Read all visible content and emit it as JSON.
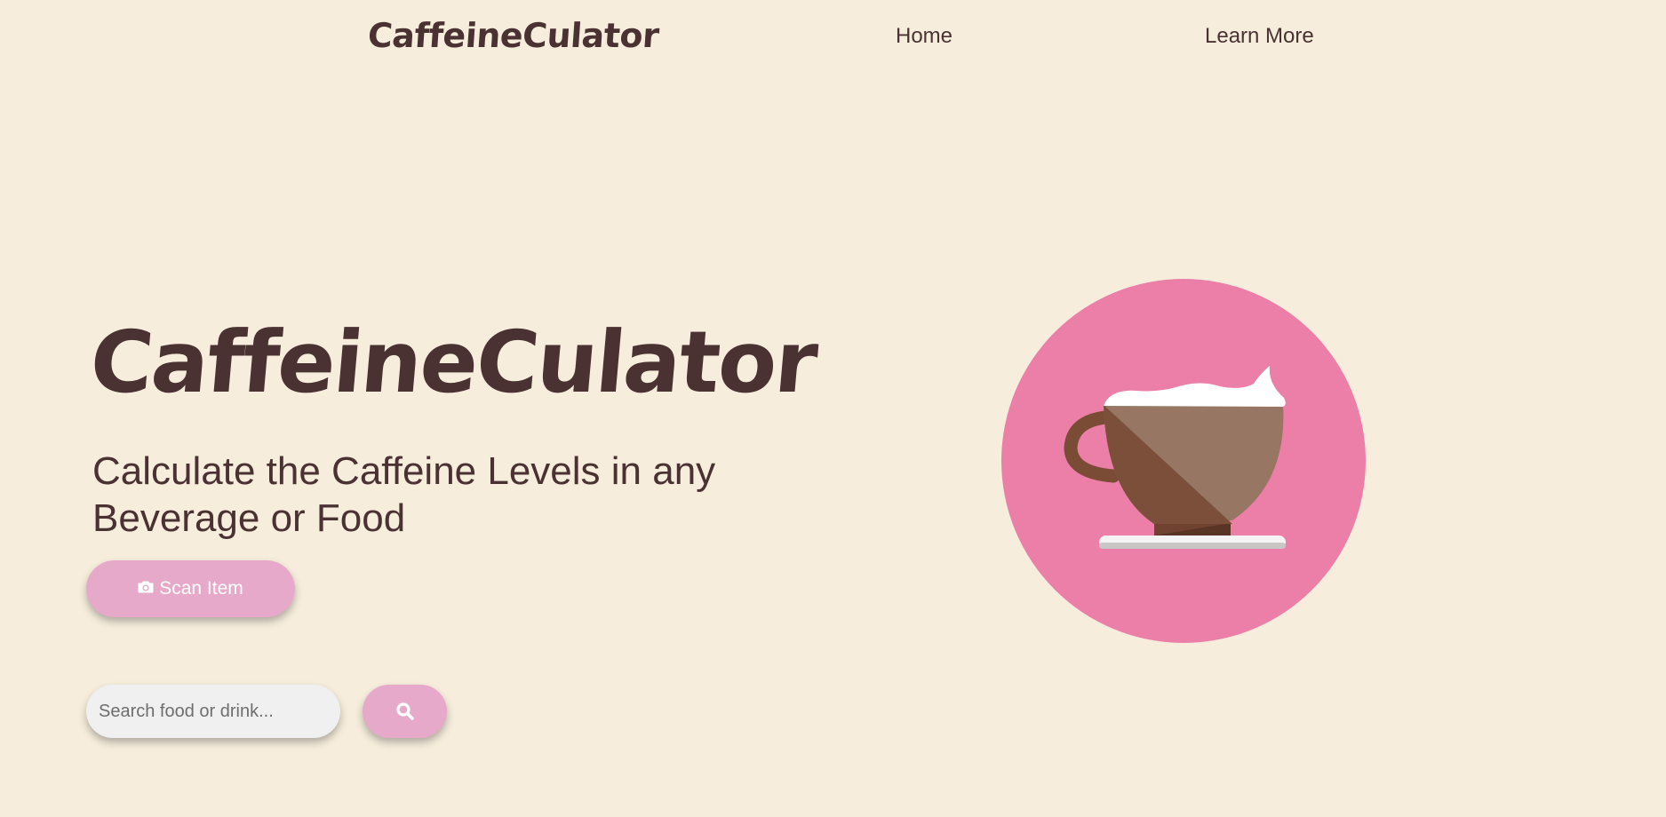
{
  "nav": {
    "brand": "CaffeineCulator",
    "links": [
      {
        "label": "Home"
      },
      {
        "label": "Learn More"
      }
    ]
  },
  "hero": {
    "title": "CaffeineCulator",
    "subtitle": "Calculate the Caffeine Levels in any Beverage or Food",
    "scan_button": {
      "label": "Scan Item",
      "icon": "camera-icon"
    }
  },
  "search": {
    "value": "",
    "placeholder": "Search food or drink...",
    "button_icon": "search-icon"
  },
  "illustration": {
    "subject": "coffee-cup-icon"
  },
  "colors": {
    "background": "#f6eddc",
    "text": "#4a3233",
    "button": "#e6a9c9",
    "circle": "#ec7fa7",
    "input": "#f0f0f0"
  }
}
